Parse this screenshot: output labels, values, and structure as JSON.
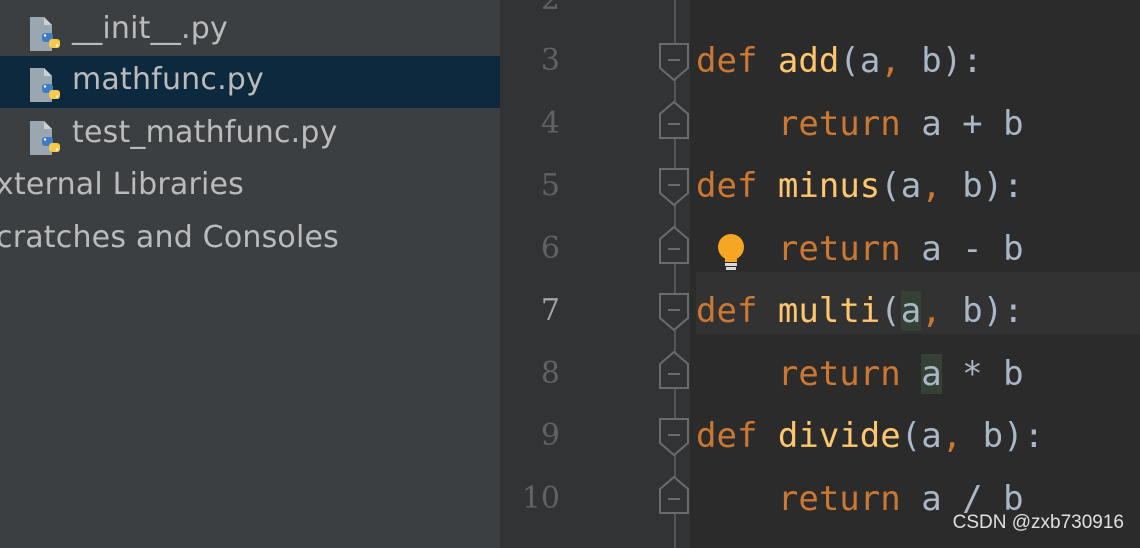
{
  "project_tree": {
    "items": [
      {
        "label": "__init__.py",
        "icon": "python-file-icon",
        "selected": false
      },
      {
        "label": "mathfunc.py",
        "icon": "python-file-icon",
        "selected": true
      },
      {
        "label": "test_mathfunc.py",
        "icon": "python-file-icon",
        "selected": false
      },
      {
        "label": "xternal Libraries"
      },
      {
        "label": "cratches and Consoles"
      }
    ]
  },
  "editor": {
    "line_numbers": [
      "2",
      "3",
      "4",
      "5",
      "6",
      "7",
      "8",
      "9",
      "10"
    ],
    "active_line": "7",
    "lines": [
      {
        "kw": "def",
        "fn": "add",
        "open": "(",
        "p1": "a",
        "comma": ",",
        "p2": "b",
        "close": "):"
      },
      {
        "kw": "return",
        "expr": "a + b"
      },
      {
        "kw": "def",
        "fn": "minus",
        "open": "(",
        "p1": "a",
        "comma": ",",
        "p2": "b",
        "close": "):"
      },
      {
        "kw": "return",
        "expr": "a - b"
      },
      {
        "kw": "def",
        "fn": "multi",
        "open": "(",
        "p1": "a",
        "comma": ",",
        "p2": "b",
        "close": "):"
      },
      {
        "kw": "return",
        "a": "a",
        "rest": " * b"
      },
      {
        "kw": "def",
        "fn": "divide",
        "open": "(",
        "p1": "a",
        "comma": ",",
        "p2": "b",
        "close": "):"
      },
      {
        "kw": "return",
        "expr": "a / b"
      }
    ],
    "intention_icon": "lightbulb-icon"
  },
  "watermark": "CSDN @zxb730916",
  "colors": {
    "tree_bg": "#3c3f41",
    "selected_bg": "#0d293e",
    "editor_bg": "#2b2b2b",
    "keyword": "#cc7832",
    "function": "#ffc66d",
    "text": "#a9b7c6",
    "bulb": "#f5a623"
  }
}
